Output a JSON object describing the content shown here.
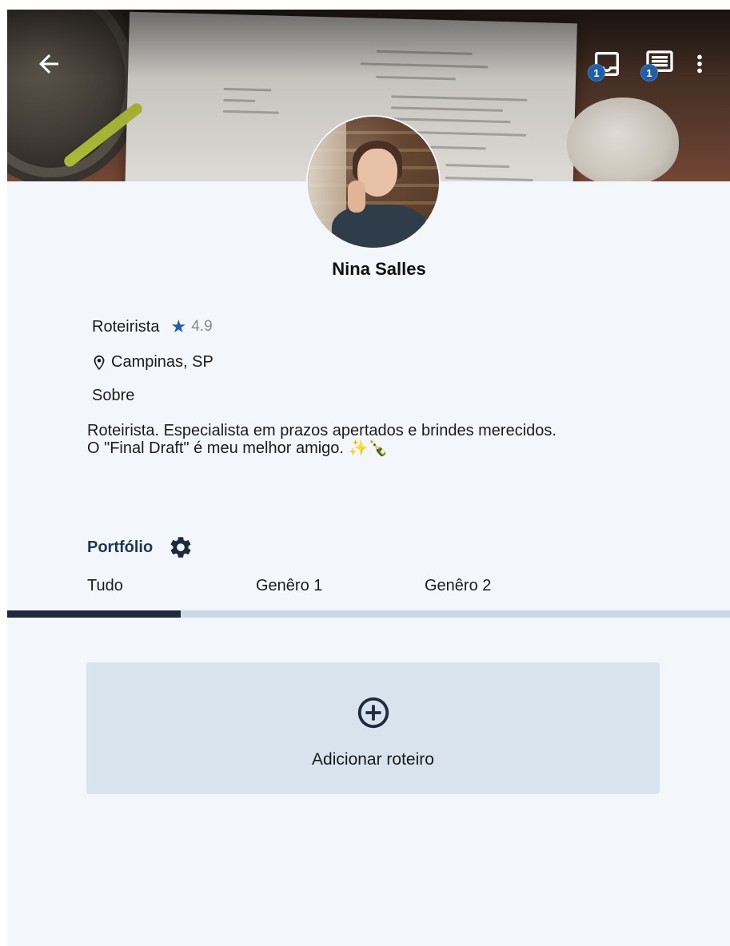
{
  "header": {
    "back_icon": "arrow-left-icon",
    "inbox_icon": "inbox-icon",
    "inbox_badge": "1",
    "chat_icon": "chat-icon",
    "chat_badge": "1",
    "more_icon": "more-vertical-icon"
  },
  "profile": {
    "name": "Nina Salles",
    "role": "Roteirista",
    "rating": "4.9",
    "location": "Campinas, SP",
    "about_label": "Sobre",
    "bio_line1": "Roteirista. Especialista em prazos apertados e brindes merecidos.",
    "bio_line2": "O \"Final Draft\" é meu melhor amigo. ✨🍾"
  },
  "portfolio": {
    "title": "Portfólio",
    "tabs": [
      "Tudo",
      "Genêro 1",
      "Genêro 2"
    ],
    "active_tab": "Tudo",
    "add_label": "Adicionar roteiro"
  },
  "colors": {
    "accent": "#1f5ea8",
    "dark": "#1d2b3d",
    "background": "#f3f7fb",
    "card": "#d9e3ee"
  }
}
